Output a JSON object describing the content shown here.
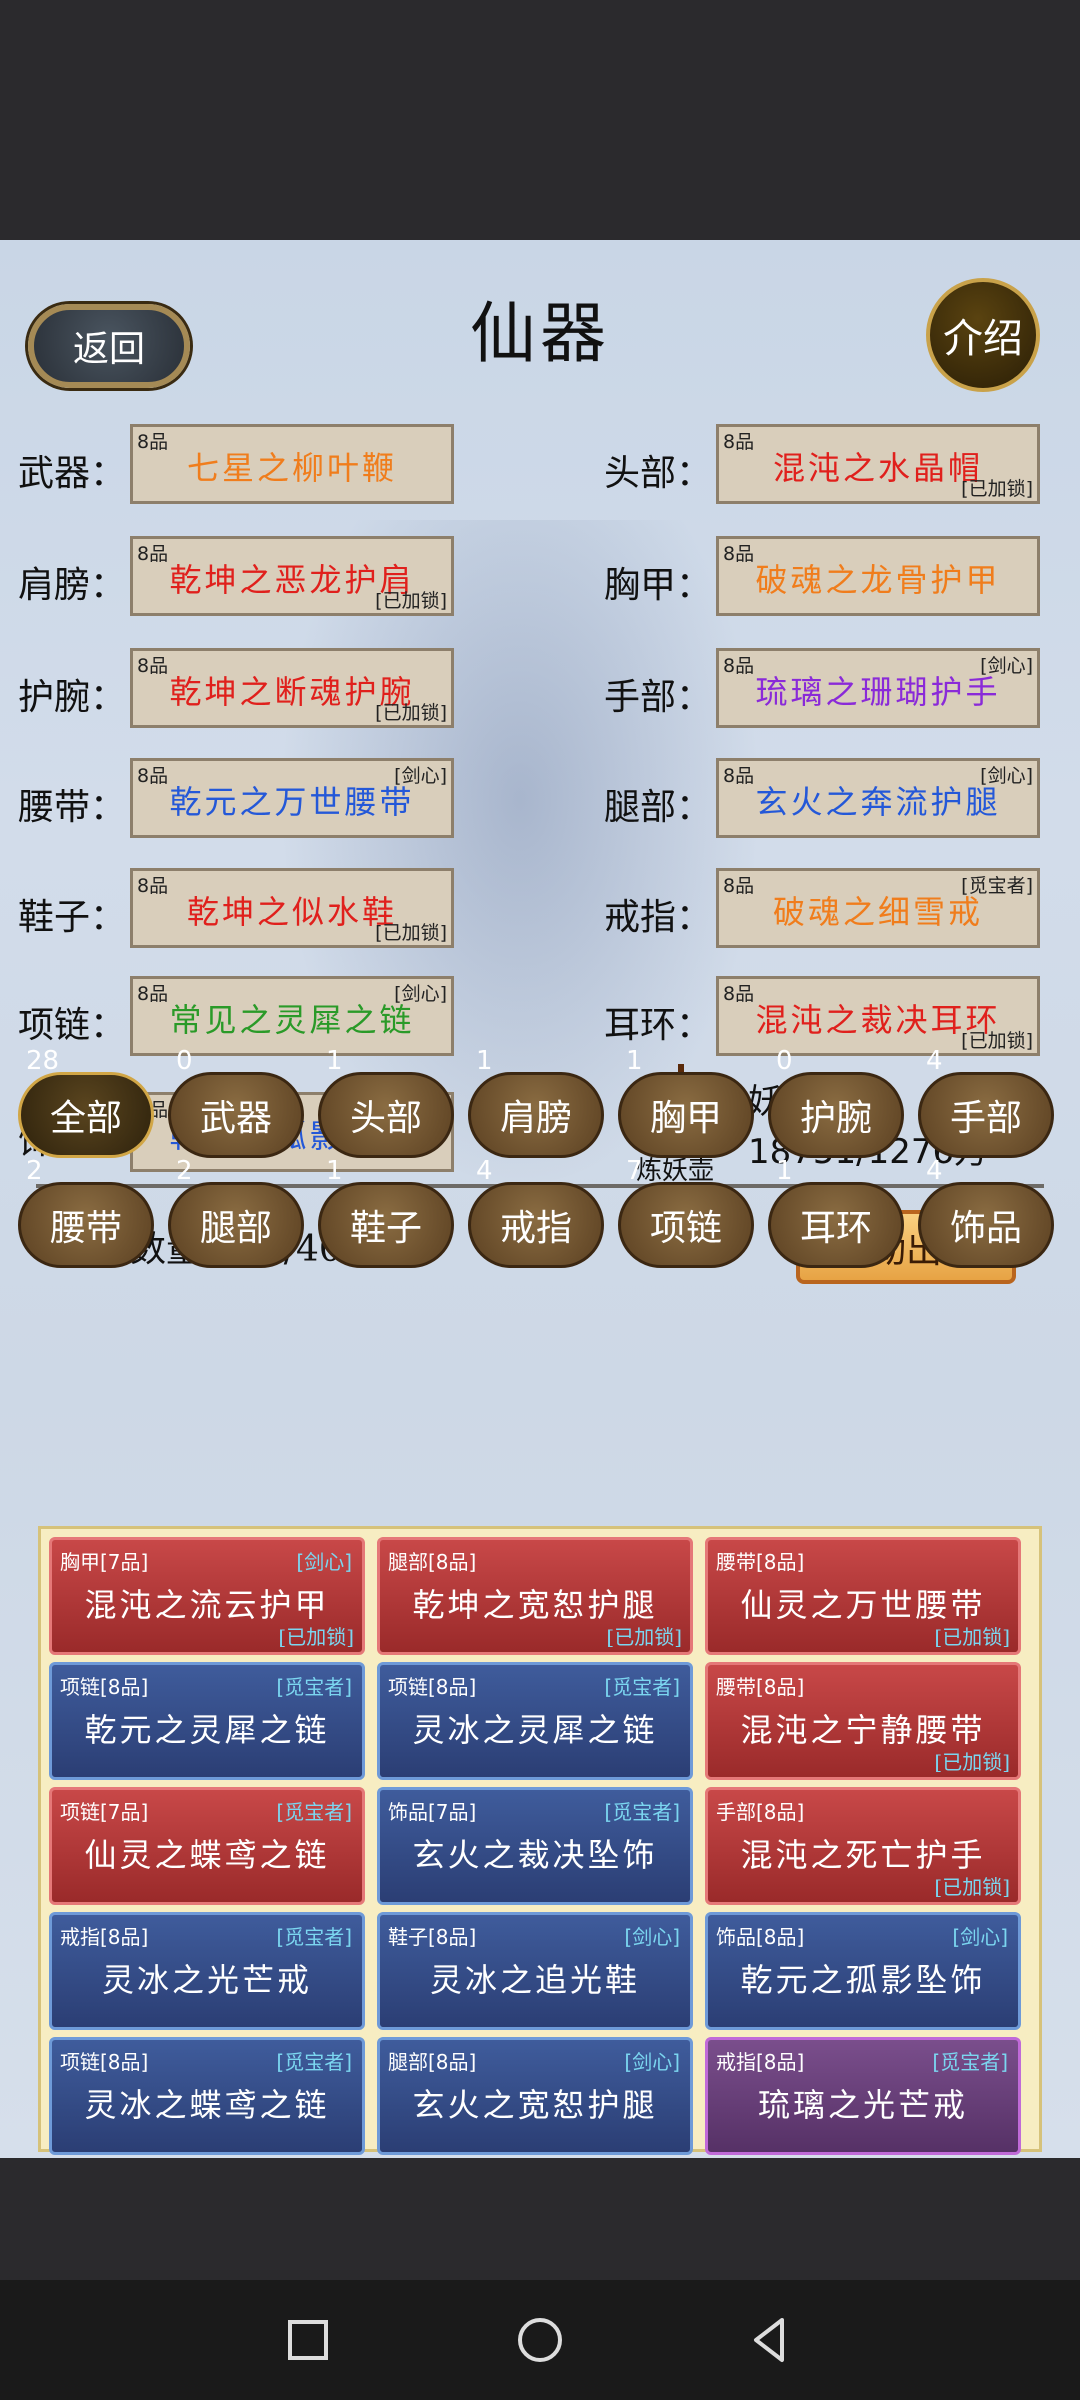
{
  "title": "仙器",
  "back_label": "返回",
  "intro_label": "介绍",
  "slots": [
    {
      "label": "武器：",
      "grade": "8品",
      "name": "七星之柳叶鞭",
      "tag": "",
      "color": "#f07d1c"
    },
    {
      "label": "头部：",
      "grade": "8品",
      "name": "混沌之水晶帽",
      "tag": "[已加锁]",
      "color": "#e0201c"
    },
    {
      "label": "肩膀：",
      "grade": "8品",
      "name": "乾坤之恶龙护肩",
      "tag": "[已加锁]",
      "color": "#e0201c"
    },
    {
      "label": "胸甲：",
      "grade": "8品",
      "name": "破魂之龙骨护甲",
      "tag": "",
      "color": "#f07d1c"
    },
    {
      "label": "护腕：",
      "grade": "8品",
      "name": "乾坤之断魂护腕",
      "tag": "[已加锁]",
      "color": "#e0201c"
    },
    {
      "label": "手部：",
      "grade": "8品",
      "name": "琉璃之珊瑚护手",
      "tag": "[剑心]",
      "color": "#8a2ad8"
    },
    {
      "label": "腰带：",
      "grade": "8品",
      "name": "乾元之万世腰带",
      "tag": "[剑心]",
      "color": "#2458d8"
    },
    {
      "label": "腿部：",
      "grade": "8品",
      "name": "玄火之奔流护腿",
      "tag": "[剑心]",
      "color": "#2458d8"
    },
    {
      "label": "鞋子：",
      "grade": "8品",
      "name": "乾坤之似水鞋",
      "tag": "[已加锁]",
      "color": "#e0201c"
    },
    {
      "label": "戒指：",
      "grade": "8品",
      "name": "破魂之细雪戒",
      "tag": "[觅宝者]",
      "color": "#f07d1c"
    },
    {
      "label": "项链：",
      "grade": "8品",
      "name": "常见之灵犀之链",
      "tag": "[剑心]",
      "color": "#2a9a28"
    },
    {
      "label": "耳环：",
      "grade": "8品",
      "name": "混沌之裁决耳环",
      "tag": "[已加锁]",
      "color": "#e0201c"
    },
    {
      "label": "饰品：",
      "grade": "8品",
      "name": "乾元之孤影坠饰",
      "tag": "[剑心]",
      "color": "#2458d8"
    }
  ],
  "soul": {
    "gourd_label": "炼妖壶",
    "title": "妖魂数量",
    "value": "18751/1276万"
  },
  "count_label": "仙器数量：28/400",
  "sell_label": "自动出售",
  "filters_row1": [
    {
      "label": "全部",
      "count": "28"
    },
    {
      "label": "武器",
      "count": "0"
    },
    {
      "label": "头部",
      "count": "1"
    },
    {
      "label": "肩膀",
      "count": "1"
    },
    {
      "label": "胸甲",
      "count": "1"
    },
    {
      "label": "护腕",
      "count": "0"
    },
    {
      "label": "手部",
      "count": "4"
    }
  ],
  "filters_row2": [
    {
      "label": "腰带",
      "count": "2"
    },
    {
      "label": "腿部",
      "count": "2"
    },
    {
      "label": "鞋子",
      "count": "1"
    },
    {
      "label": "戒指",
      "count": "4"
    },
    {
      "label": "项链",
      "count": "7"
    },
    {
      "label": "耳环",
      "count": "1"
    },
    {
      "label": "饰品",
      "count": "4"
    }
  ],
  "cards": [
    {
      "type": "胸甲[7品]",
      "tag": "[剑心]",
      "name": "混沌之流云护甲",
      "lock": "[已加锁]",
      "style": "red"
    },
    {
      "type": "腿部[8品]",
      "tag": "",
      "name": "乾坤之宽恕护腿",
      "lock": "[已加锁]",
      "style": "red"
    },
    {
      "type": "腰带[8品]",
      "tag": "",
      "name": "仙灵之万世腰带",
      "lock": "[已加锁]",
      "style": "red"
    },
    {
      "type": "项链[8品]",
      "tag": "[觅宝者]",
      "name": "乾元之灵犀之链",
      "lock": "",
      "style": "blue"
    },
    {
      "type": "项链[8品]",
      "tag": "[觅宝者]",
      "name": "灵冰之灵犀之链",
      "lock": "",
      "style": "blue"
    },
    {
      "type": "腰带[8品]",
      "tag": "",
      "name": "混沌之宁静腰带",
      "lock": "[已加锁]",
      "style": "red"
    },
    {
      "type": "项链[7品]",
      "tag": "[觅宝者]",
      "name": "仙灵之蝶鸢之链",
      "lock": "",
      "style": "red"
    },
    {
      "type": "饰品[7品]",
      "tag": "[觅宝者]",
      "name": "玄火之裁决坠饰",
      "lock": "",
      "style": "blue"
    },
    {
      "type": "手部[8品]",
      "tag": "",
      "name": "混沌之死亡护手",
      "lock": "[已加锁]",
      "style": "red"
    },
    {
      "type": "戒指[8品]",
      "tag": "[觅宝者]",
      "name": "灵冰之光芒戒",
      "lock": "",
      "style": "blue"
    },
    {
      "type": "鞋子[8品]",
      "tag": "[剑心]",
      "name": "灵冰之追光鞋",
      "lock": "",
      "style": "blue"
    },
    {
      "type": "饰品[8品]",
      "tag": "[剑心]",
      "name": "乾元之孤影坠饰",
      "lock": "",
      "style": "blue"
    },
    {
      "type": "项链[8品]",
      "tag": "[觅宝者]",
      "name": "灵冰之蝶鸢之链",
      "lock": "",
      "style": "blue"
    },
    {
      "type": "腿部[8品]",
      "tag": "[剑心]",
      "name": "玄火之宽恕护腿",
      "lock": "",
      "style": "blue"
    },
    {
      "type": "戒指[8品]",
      "tag": "[觅宝者]",
      "name": "琉璃之光芒戒",
      "lock": "",
      "style": "purple"
    }
  ]
}
